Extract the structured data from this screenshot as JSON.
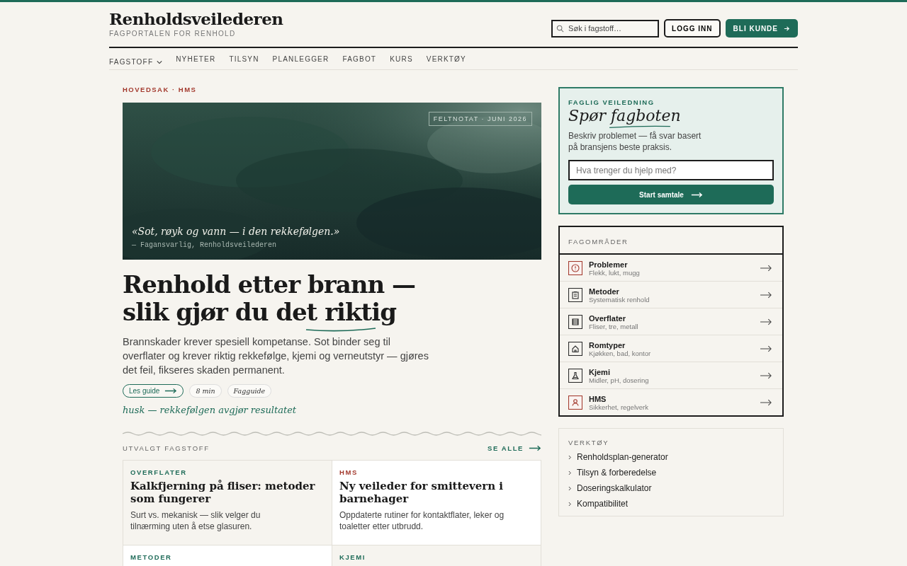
{
  "header": {
    "logo": "Renholdsveilederen",
    "tagline": "FAGPORTALEN FOR RENHOLD",
    "search": {
      "placeholder": "Søk i fagstoff…"
    },
    "login": "LOGG INN",
    "signup": "BLI KUNDE"
  },
  "nav": [
    {
      "label": "FAGSTOFF",
      "kind": "dropdown"
    },
    {
      "label": "NYHETER",
      "kind": "link"
    },
    {
      "label": "TILSYN",
      "kind": "link"
    },
    {
      "label": "PLANLEGGER",
      "kind": "link"
    },
    {
      "label": "FAGBOT",
      "kind": "link"
    },
    {
      "label": "KURS",
      "kind": "link"
    },
    {
      "label": "VERKTØY",
      "kind": "link"
    }
  ],
  "feature": {
    "kicker": "HOVEDSAK · HMS",
    "image": {
      "tag": "FELTNOTAT · JUNI 2026",
      "quote": "«Sot, røyk og vann — i den rekkefølgen.»",
      "attribution": "— Fagansvarlig, Renholdsveilederen"
    },
    "title": "Renhold etter brann — slik gjør du det riktig",
    "lead": "Brannskader krever spesiell kompetanse. Sot binder seg til overflater og krever riktig rekkefølge, kjemi og verneutstyr — gjøres det feil, fikseres skaden permanent.",
    "cta": "Les guide",
    "chips": [
      "8 min",
      "Fagguide"
    ],
    "note": "husk — rekkefølgen avgjør resultatet"
  },
  "selected": {
    "title": "UTVALGT FAGSTOFF",
    "see_all": "SE ALLE",
    "cards": [
      {
        "tag": "OVERFLATER",
        "color": "#1e6b58",
        "shaded": true,
        "title": "Kalkfjerning på fliser: metoder som fungerer",
        "text": "Surt vs. mekanisk — slik velger du tilnærming uten å etse glasuren."
      },
      {
        "tag": "HMS",
        "color": "#a33a2e",
        "shaded": false,
        "title": "Ny veileder for smittevern i barnehager",
        "text": "Oppdaterte rutiner for kontaktflater, leker og toaletter etter utbrudd."
      },
      {
        "tag": "METODER",
        "color": "#1e6b58",
        "shaded": false
      },
      {
        "tag": "KJEMI",
        "color": "#1e6b58",
        "shaded": true
      }
    ]
  },
  "bot": {
    "kicker": "FAGLIG VEILEDNING",
    "title": "Spør fagboten",
    "text": "Beskriv problemet — få svar basert på bransjens beste praksis.",
    "input": {
      "placeholder": "Hva trenger du hjelp med?"
    },
    "button": "Start samtale"
  },
  "areas": {
    "title": "FAGOMRÅDER",
    "items": [
      {
        "kind": "alert",
        "color": "#a33a2e",
        "name": "Problemer",
        "sub": "Flekk, lukt, mugg"
      },
      {
        "kind": "clipboard",
        "color": "#2b2b2b",
        "name": "Metoder",
        "sub": "Systematisk renhold"
      },
      {
        "kind": "grid",
        "color": "#2b2b2b",
        "name": "Overflater",
        "sub": "Fliser, tre, metall"
      },
      {
        "kind": "house",
        "color": "#2b2b2b",
        "name": "Romtyper",
        "sub": "Kjøkken, bad, kontor"
      },
      {
        "kind": "flask",
        "color": "#2b2b2b",
        "name": "Kjemi",
        "sub": "Midler, pH, dosering"
      },
      {
        "kind": "person",
        "color": "#a33a2e",
        "name": "HMS",
        "sub": "Sikkerhet, regelverk"
      }
    ]
  },
  "tools": {
    "title": "VERKTØY",
    "items": [
      "Renholdsplan-generator",
      "Tilsyn & forberedelse",
      "Doseringskalkulator",
      "Kompatibilitet"
    ]
  }
}
